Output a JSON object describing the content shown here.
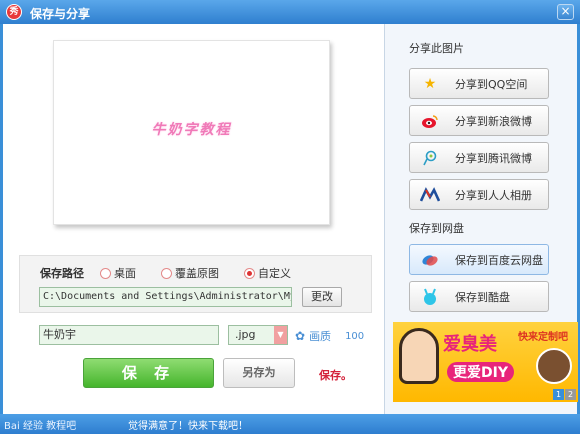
{
  "titlebar": {
    "logo_text": "秀",
    "title": "保存与分享",
    "close_symbol": "×"
  },
  "preview": {
    "watermark": "牛奶字教程"
  },
  "path": {
    "label": "保存路径",
    "options": [
      {
        "label": "桌面",
        "selected": false
      },
      {
        "label": "覆盖原图",
        "selected": false
      },
      {
        "label": "自定义",
        "selected": true
      }
    ],
    "value": "C:\\Documents and Settings\\Administrator\\My",
    "change_label": "更改"
  },
  "file": {
    "name": "牛奶宇",
    "ext": ".jpg",
    "quality_label": "画质",
    "quality_value": "100"
  },
  "actions": {
    "save_label": "保 存",
    "saveas_label": "另存为",
    "save_hint": "保存。"
  },
  "share": {
    "section_title": "分享此图片",
    "buttons": [
      {
        "label": "分享到QQ空间",
        "icon": "star-icon"
      },
      {
        "label": "分享到新浪微博",
        "icon": "weibo-icon"
      },
      {
        "label": "分享到腾讯微博",
        "icon": "tencent-weibo-icon"
      },
      {
        "label": "分享到人人相册",
        "icon": "renren-icon"
      }
    ]
  },
  "cloud": {
    "section_title": "保存到网盘",
    "buttons": [
      {
        "label": "保存到百度云网盘",
        "icon": "baidu-cloud-icon"
      },
      {
        "label": "保存到酷盘",
        "icon": "kupan-icon"
      }
    ]
  },
  "banner": {
    "line1": "爱臭美",
    "line2": "更爱DIY",
    "corner": "快来定制吧",
    "pages": [
      "1",
      "2"
    ]
  },
  "statusbar": {
    "watermark": "Bai 经验 教程吧",
    "message": "觉得满意了！快来下载吧！"
  },
  "colors": {
    "title_bar": "#2f7fcf",
    "save_green": "#45b52c",
    "hint_red": "#d4213a",
    "field_bg": "#eaf6ea"
  }
}
